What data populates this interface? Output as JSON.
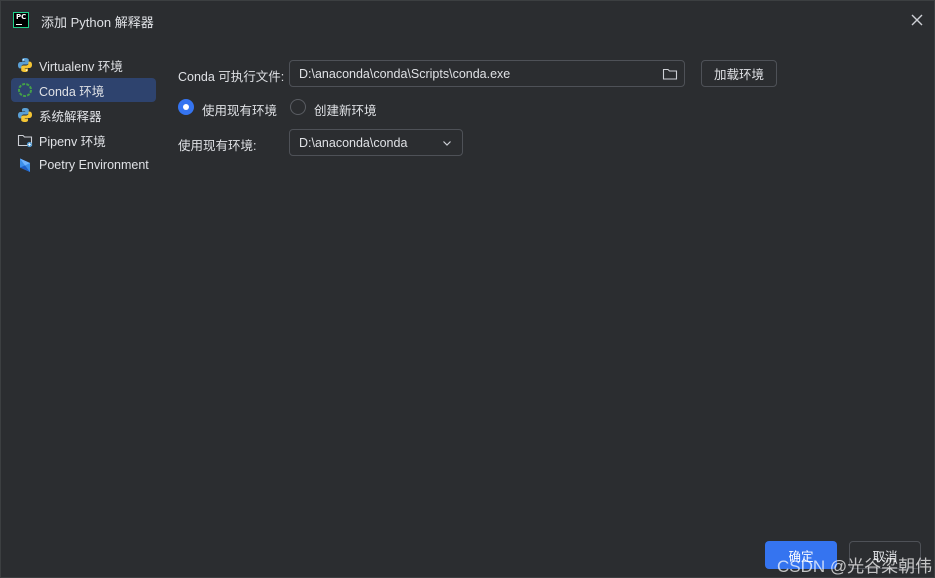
{
  "window": {
    "title": "添加 Python 解释器"
  },
  "sidebar": {
    "items": [
      {
        "label": "Virtualenv 环境",
        "icon": "python-icon",
        "active": false
      },
      {
        "label": "Conda 环境",
        "icon": "conda-icon",
        "active": true
      },
      {
        "label": "系统解释器",
        "icon": "python-icon",
        "active": false
      },
      {
        "label": "Pipenv 环境",
        "icon": "pipenv-folder-icon",
        "active": false
      },
      {
        "label": "Poetry Environment",
        "icon": "poetry-icon",
        "active": false
      }
    ]
  },
  "conda": {
    "exe_label": "Conda 可执行文件:",
    "exe_value": "D:\\anaconda\\conda\\Scripts\\conda.exe",
    "load_button": "加载环境",
    "radio_existing": "使用现有环境",
    "radio_new": "创建新环境",
    "selected_radio": "existing",
    "env_label": "使用现有环境:",
    "env_value": "D:\\anaconda\\conda"
  },
  "footer": {
    "ok": "确定",
    "cancel": "取消"
  },
  "watermark": "CSDN @光谷梁朝伟",
  "colors": {
    "background": "#2b2d30",
    "accent": "#3574f0",
    "selected_item": "#2e436e",
    "border": "#4e5157"
  }
}
